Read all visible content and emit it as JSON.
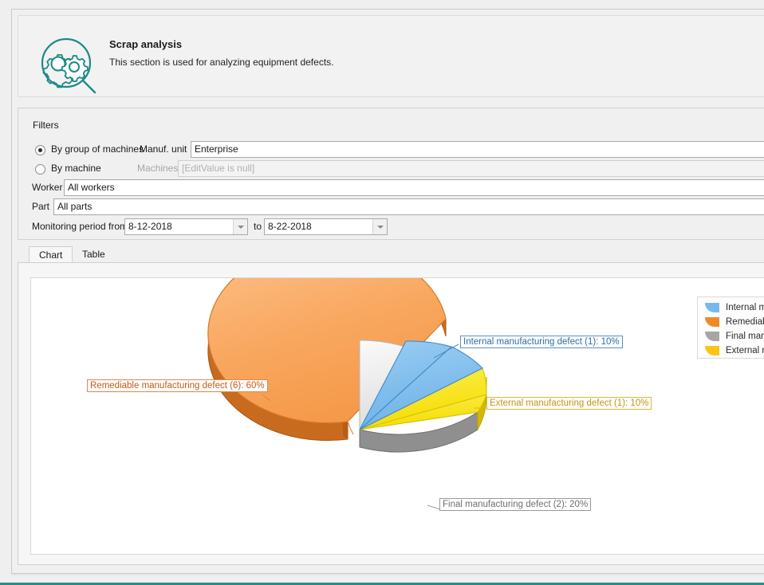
{
  "header": {
    "icon": "gear-magnifier-icon",
    "title": "Scrap analysis",
    "subtitle": "This section is used for analyzing equipment defects.",
    "accent_color": "#1d8a87"
  },
  "filters": {
    "legend": "Filters",
    "by_group_label": "By group of machines",
    "by_machine_label": "By machine",
    "by_group_selected": true,
    "by_machine_selected": false,
    "manuf_unit_label": "Manuf. unit",
    "manuf_unit_value": "Enterprise",
    "machines_label": "Machines",
    "machines_value": "[EditValue is null]",
    "machines_disabled": true,
    "worker_label": "Worker",
    "worker_value": "All workers",
    "part_label": "Part",
    "part_value": "All parts",
    "period_label": "Monitoring period from",
    "period_to_label": "to",
    "date_from": "8-12-2018",
    "date_to": "8-22-2018"
  },
  "tabs": [
    {
      "label": "Chart",
      "active": true
    },
    {
      "label": "Table",
      "active": false
    }
  ],
  "legend": {
    "items": [
      {
        "label": "Internal manufac",
        "color": "#78B9ED"
      },
      {
        "label": "Remediable man",
        "color": "#EF8A2B"
      },
      {
        "label": "Final manufactur",
        "color": "#A6A6A6"
      },
      {
        "label": "External manufac",
        "color": "#FBC416"
      }
    ]
  },
  "chart_data": {
    "type": "pie",
    "title": "",
    "three_d": true,
    "exploded_slice": "Remediable manufacturing defect",
    "categories": [
      "Internal manufacturing defect",
      "External manufacturing defect",
      "Final manufacturing defect",
      "Remediable manufacturing defect"
    ],
    "counts": [
      1,
      1,
      2,
      6
    ],
    "values": [
      10,
      20,
      20,
      60
    ],
    "percent_values": [
      10,
      10,
      20,
      60
    ],
    "colors": [
      "#78B9ED",
      "#FBE315",
      "#E8E8E8",
      "#F9A861"
    ],
    "edge_colors": [
      "#2E7DBF",
      "#C9A400",
      "#6E6E6E",
      "#B05C18"
    ],
    "labels": [
      {
        "text": "Internal manufacturing defect (1): 10%",
        "color": "#2E6DA4",
        "border": "#5A8FC0"
      },
      {
        "text": "External manufacturing defect (1): 10%",
        "color": "#C2950C",
        "border": "#D9B83C"
      },
      {
        "text": "Final manufacturing defect (2): 20%",
        "color": "#6E6E6E",
        "border": "#9A9A9A"
      },
      {
        "text": "Remediable manufacturing defect (6): 60%",
        "color": "#C05A18",
        "border": "#D88A4A"
      }
    ],
    "legend_position": "top-right",
    "grid": false
  }
}
